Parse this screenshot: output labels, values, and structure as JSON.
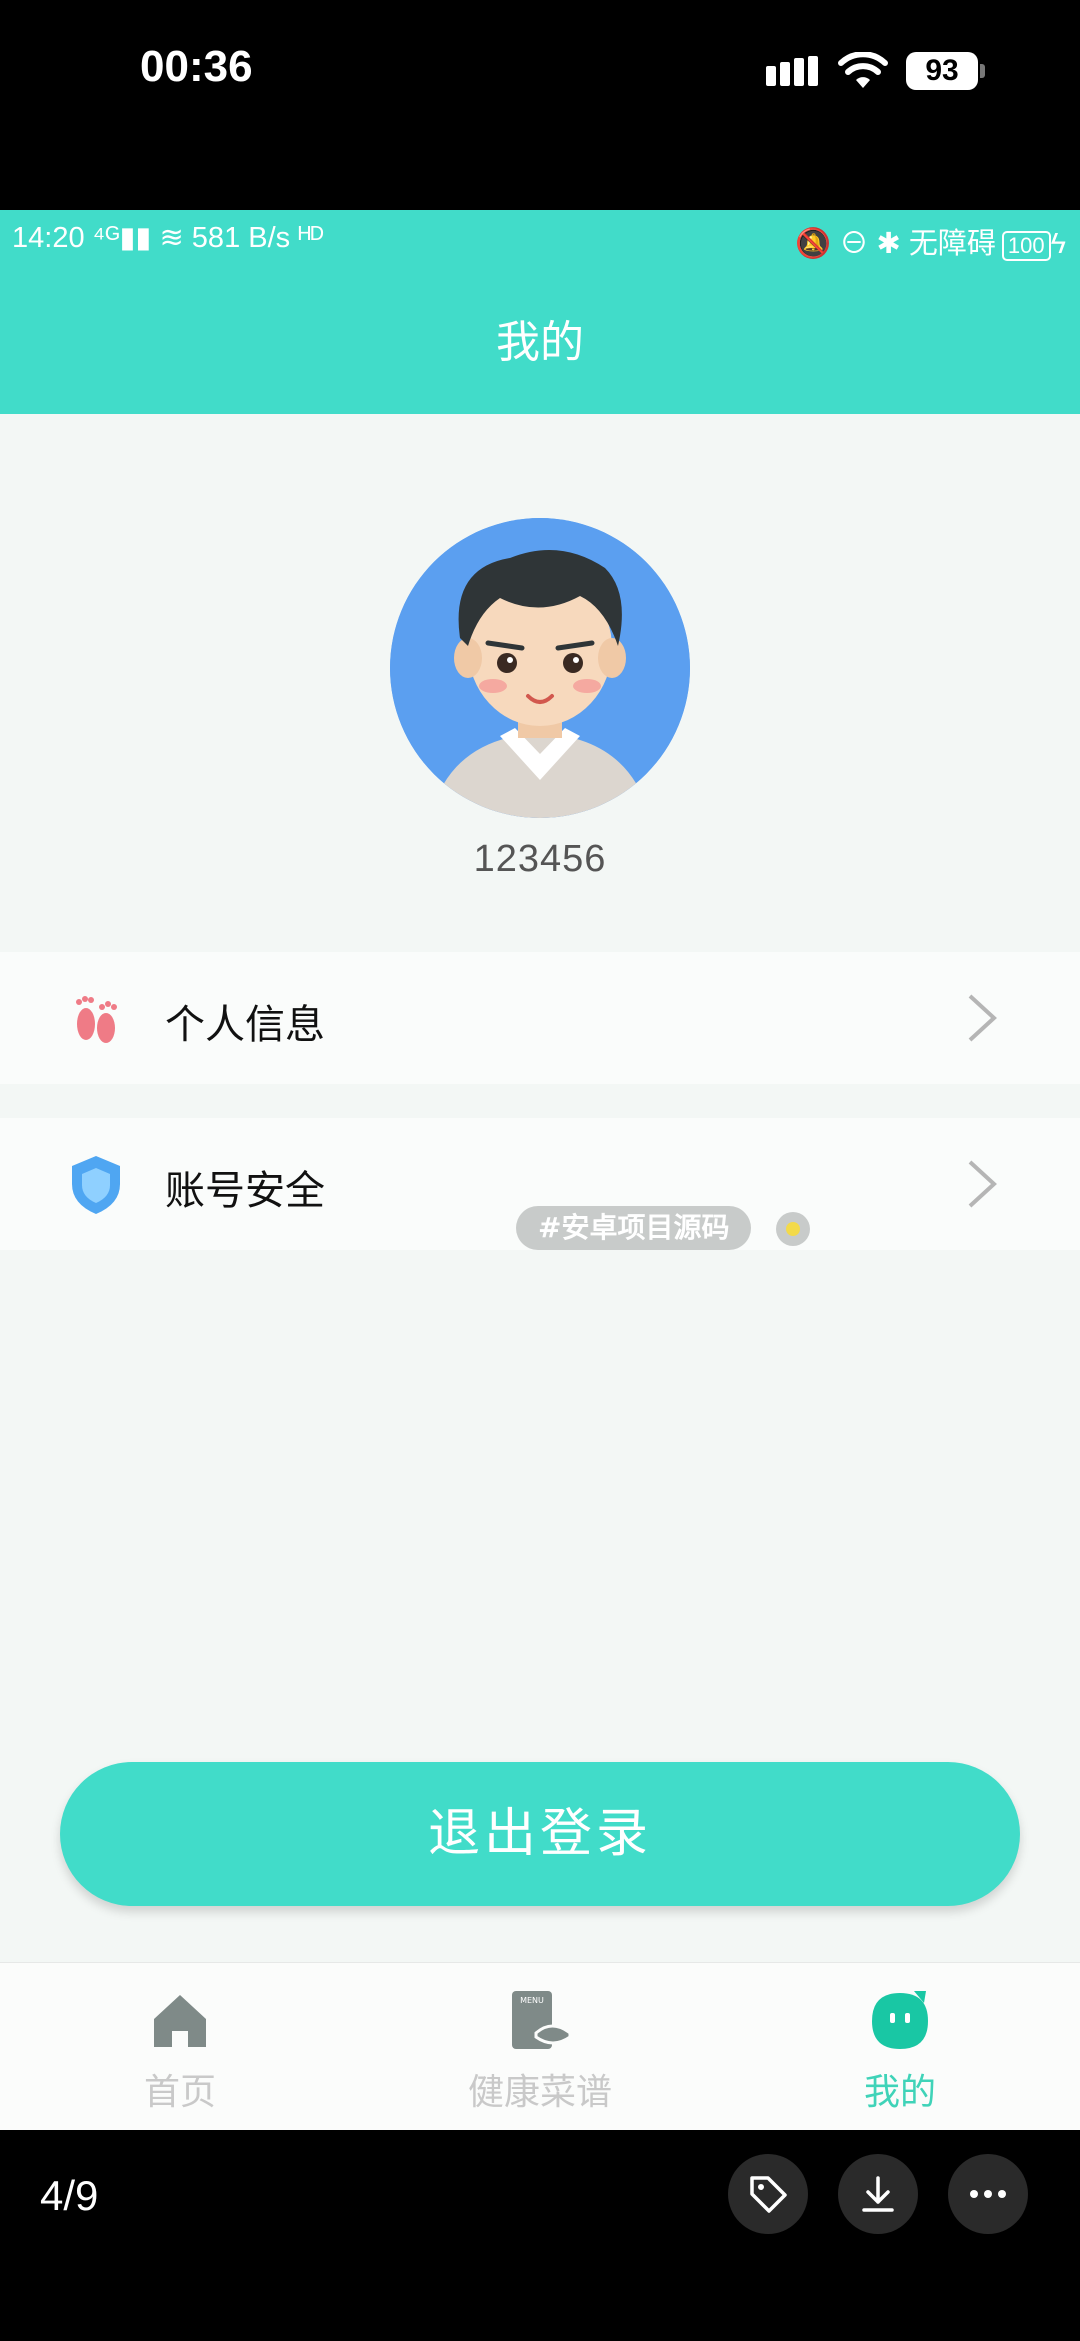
{
  "ios_status": {
    "time": "00:36",
    "battery": "93"
  },
  "android_status": {
    "left": "14:20 ⁴ᴳ▮▮ ≋ 581 B/s ᴴᴰ",
    "right": "🔕 ⊖ ✱ 无障碍",
    "battery": "100"
  },
  "header": {
    "title": "我的"
  },
  "profile": {
    "username": "123456"
  },
  "menu": [
    {
      "label": "个人信息",
      "icon": "footprint-icon"
    },
    {
      "label": "账号安全",
      "icon": "shield-icon"
    }
  ],
  "watermark": {
    "tag": "#安卓项目源码"
  },
  "logout": {
    "label": "退出登录"
  },
  "bottom_nav": {
    "items": [
      {
        "label": "首页",
        "icon": "home-icon"
      },
      {
        "label": "健康菜谱",
        "icon": "menu-book-icon"
      },
      {
        "label": "我的",
        "icon": "mine-icon",
        "active": true
      }
    ]
  },
  "viewer": {
    "page_counter": "4/9"
  },
  "colors": {
    "accent": "#41dcc9",
    "active_nav": "#3fd3b8"
  }
}
